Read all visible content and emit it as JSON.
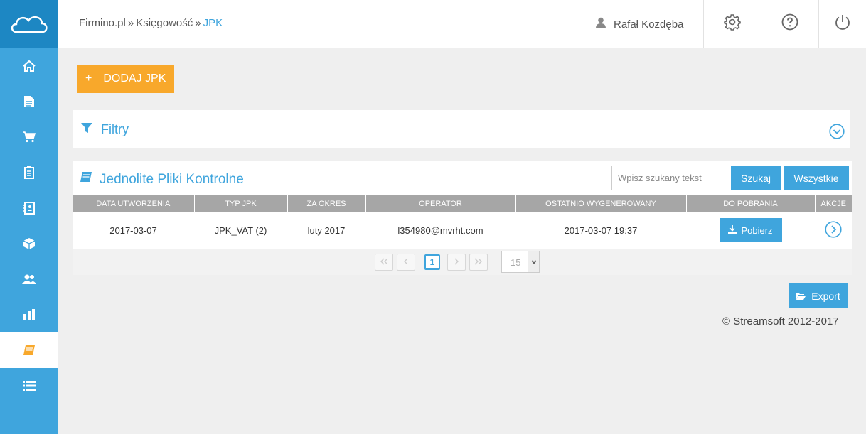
{
  "app": {
    "logo_icon": "cloud-logo-icon",
    "accent_color": "#3fa5dd",
    "orange_color": "#f8a82b"
  },
  "sidebar": {
    "items": [
      {
        "icon": "home-icon"
      },
      {
        "icon": "document-icon"
      },
      {
        "icon": "cart-icon"
      },
      {
        "icon": "clipboard-icon"
      },
      {
        "icon": "contacts-book-icon"
      },
      {
        "icon": "box-icon"
      },
      {
        "icon": "users-icon"
      },
      {
        "icon": "bar-chart-icon"
      },
      {
        "icon": "book-icon",
        "active": true
      },
      {
        "icon": "list-icon"
      }
    ]
  },
  "header": {
    "breadcrumb": [
      {
        "label": "Firmino.pl"
      },
      {
        "label": "Księgowość"
      },
      {
        "label": "JPK"
      }
    ],
    "separator": "»",
    "user_name": "Rafał Kozdęba",
    "icons": [
      "settings-icon",
      "help-icon",
      "power-icon"
    ]
  },
  "actions": {
    "add_plus": "+",
    "add_label": "DODAJ JPK"
  },
  "filters": {
    "title": "Filtry"
  },
  "jpk_panel": {
    "title": "Jednolite Pliki Kontrolne",
    "search_placeholder": "Wpisz szukany tekst",
    "search_button": "Szukaj",
    "all_button": "Wszystkie",
    "columns": [
      "DATA UTWORZENIA",
      "TYP JPK",
      "ZA OKRES",
      "OPERATOR",
      "OSTATNIO WYGENEROWANY",
      "DO POBRANIA",
      "AKCJE"
    ],
    "rows": [
      {
        "created": "2017-03-07",
        "type": "JPK_VAT (2)",
        "period": "luty 2017",
        "operator": "l354980@mvrht.com",
        "last_generated": "2017-03-07 19:37",
        "download_label": "Pobierz"
      }
    ],
    "pagination": {
      "current_page": "1",
      "page_size": "15"
    }
  },
  "footer": {
    "export_label": "Export",
    "copyright": "© Streamsoft 2012-2017"
  }
}
